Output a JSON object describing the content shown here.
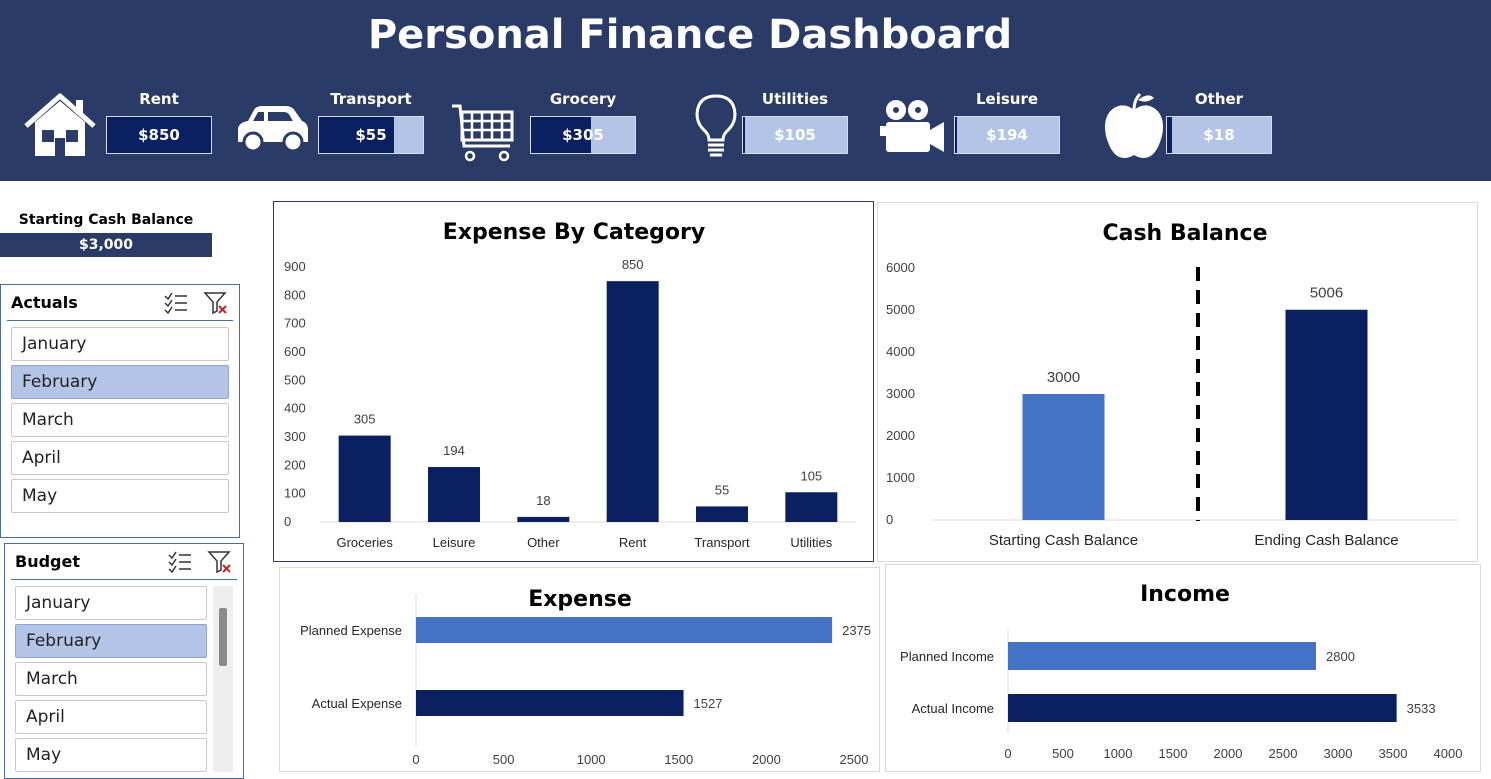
{
  "header": {
    "title": "Personal Finance Dashboard",
    "kpis": [
      {
        "label": "Rent",
        "value": "$850",
        "fill": 1.0,
        "icon": "house-icon"
      },
      {
        "label": "Transport",
        "value": "$55",
        "fill": 0.72,
        "icon": "car-icon"
      },
      {
        "label": "Grocery",
        "value": "$305",
        "fill": 0.58,
        "icon": "shopping-cart-icon"
      },
      {
        "label": "Utilities",
        "value": "$105",
        "fill": 0.02,
        "icon": "light-bulb-icon"
      },
      {
        "label": "Leisure",
        "value": "$194",
        "fill": 0.02,
        "icon": "film-camera-icon"
      },
      {
        "label": "Other",
        "value": "$18",
        "fill": 0.05,
        "icon": "apple-icon"
      }
    ]
  },
  "starting_cash": {
    "label": "Starting Cash Balance",
    "value": "$3,000"
  },
  "slicers": {
    "actuals": {
      "title": "Actuals",
      "items": [
        "January",
        "February",
        "March",
        "April",
        "May"
      ],
      "selected": "February"
    },
    "budget": {
      "title": "Budget",
      "items": [
        "January",
        "February",
        "March",
        "April",
        "May"
      ],
      "selected": "February"
    }
  },
  "colors": {
    "dark_navy": "#0a2060",
    "medium_blue": "#4472c4",
    "header_bg": "#2b3b67",
    "slicer_selected": "#b4c4e7"
  },
  "chart_data": [
    {
      "type": "bar",
      "title": "Expense By Category",
      "categories": [
        "Groceries",
        "Leisure",
        "Other",
        "Rent",
        "Transport",
        "Utilities"
      ],
      "values": [
        305,
        194,
        18,
        850,
        55,
        105
      ],
      "ylim": [
        0,
        900
      ],
      "yticks": [
        0,
        100,
        200,
        300,
        400,
        500,
        600,
        700,
        800,
        900
      ],
      "grid": false,
      "legend": "none"
    },
    {
      "type": "bar",
      "title": "Cash Balance",
      "categories": [
        "Starting Cash Balance",
        "Ending Cash Balance"
      ],
      "values": [
        3000,
        5006
      ],
      "ylim": [
        0,
        6000
      ],
      "yticks": [
        0,
        1000,
        2000,
        3000,
        4000,
        5000,
        6000
      ],
      "grid": false,
      "legend": "none"
    },
    {
      "type": "bar",
      "orientation": "horizontal",
      "title": "Expense",
      "categories": [
        "Planned Expense",
        "Actual Expense"
      ],
      "values": [
        2375,
        1527
      ],
      "xlim": [
        0,
        2500
      ],
      "xticks": [
        0,
        500,
        1000,
        1500,
        2000,
        2500
      ],
      "grid": false,
      "legend": "none"
    },
    {
      "type": "bar",
      "orientation": "horizontal",
      "title": "Income",
      "categories": [
        "Planned Income",
        "Actual Income"
      ],
      "values": [
        2800,
        3533
      ],
      "xlim": [
        0,
        4000
      ],
      "xticks": [
        0,
        500,
        1000,
        1500,
        2000,
        2500,
        3000,
        3500,
        4000
      ],
      "grid": false,
      "legend": "none"
    }
  ]
}
